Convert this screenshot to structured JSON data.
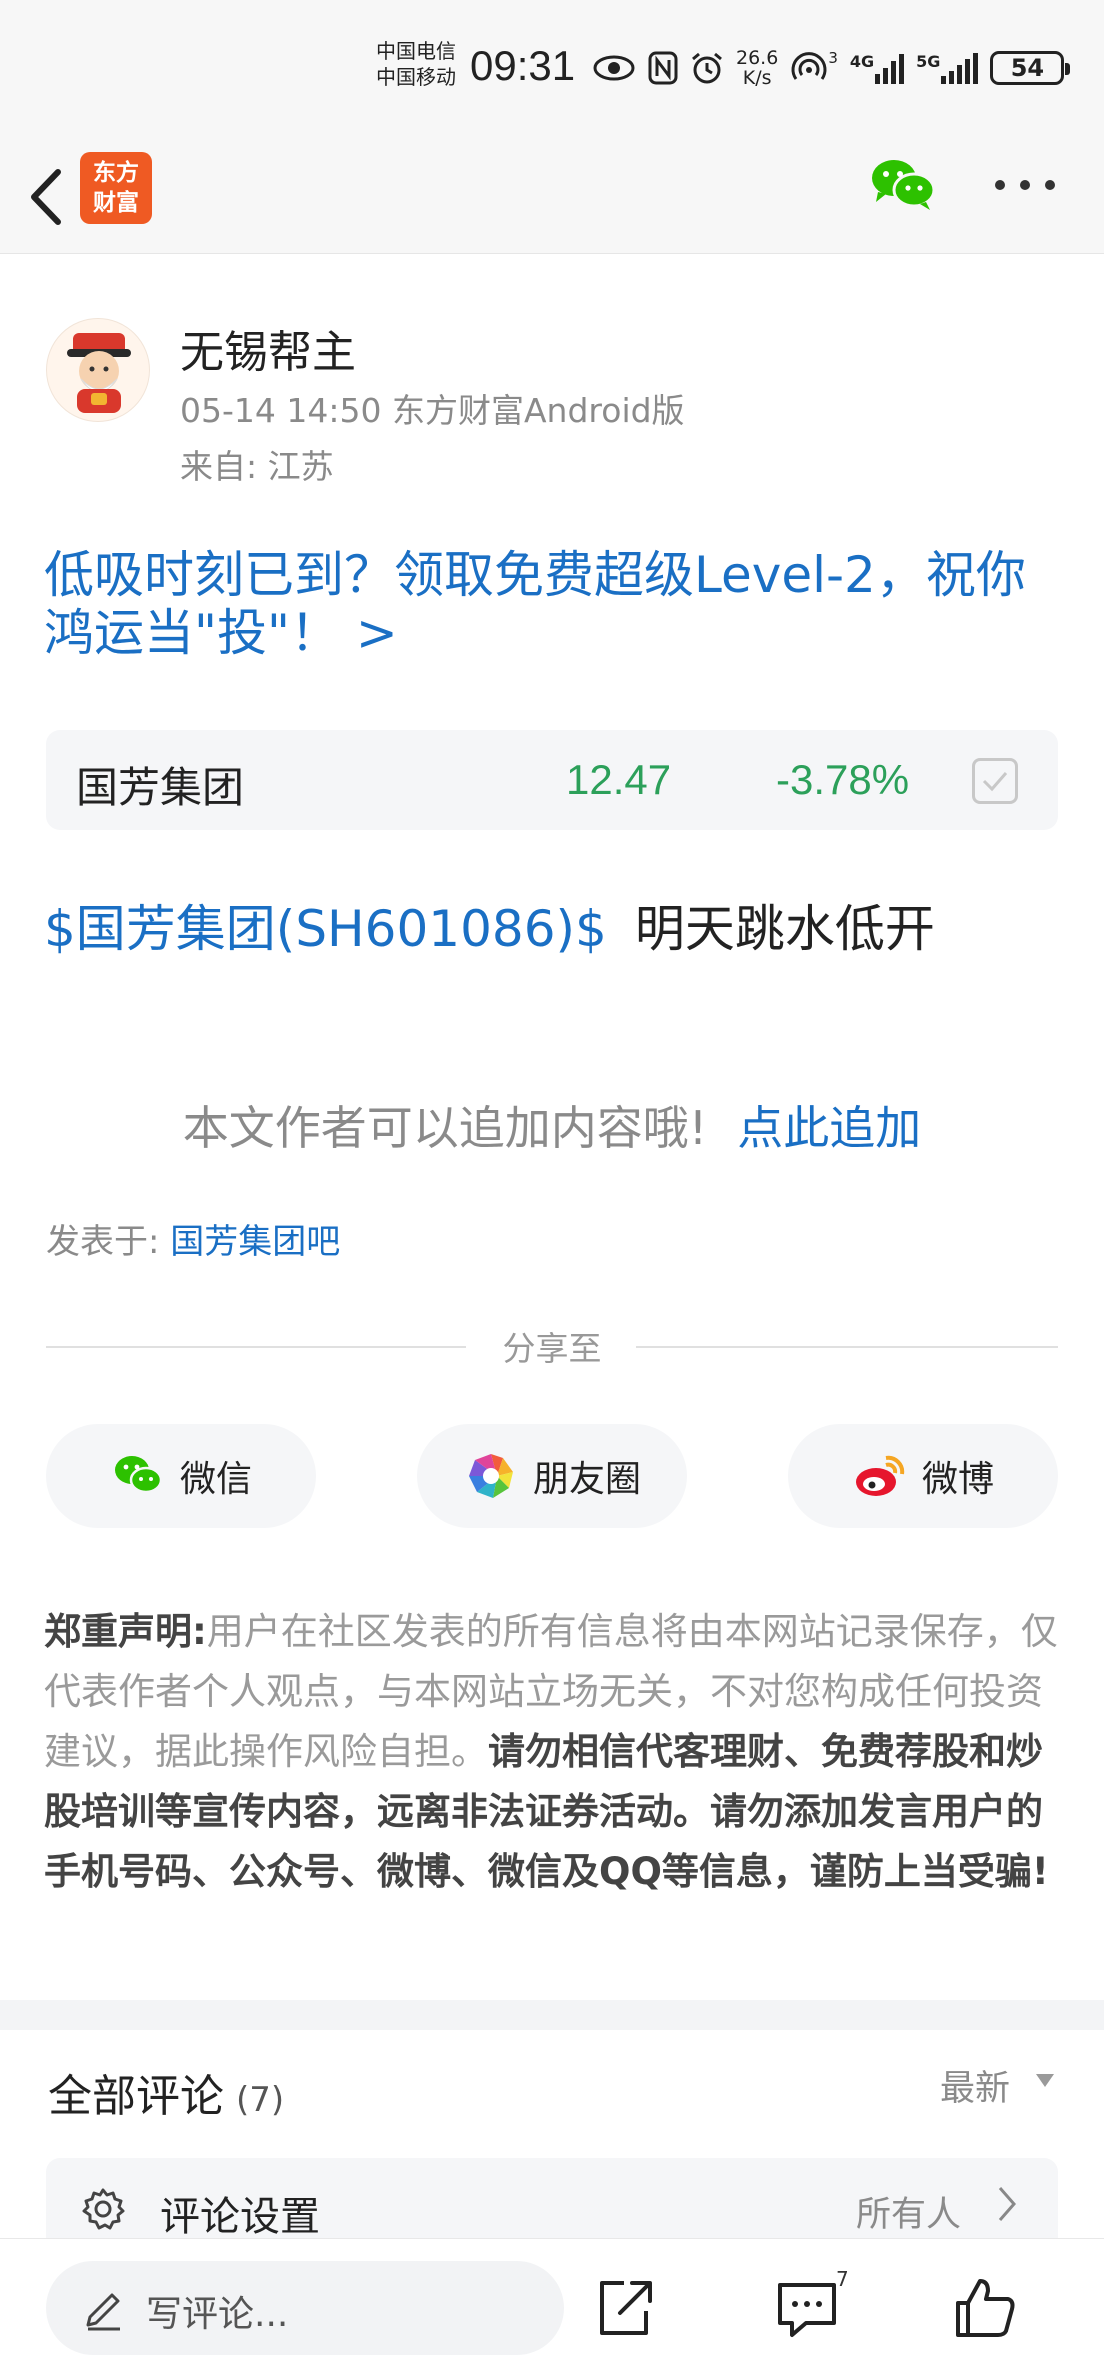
{
  "status_bar": {
    "carrier_1": "中国电信",
    "carrier_2": "中国移动",
    "time": "09:31",
    "net_speed_value": "26.6",
    "net_speed_unit": "K/s",
    "hotspot_sub": "3",
    "signal_1_label": "4G",
    "signal_2_label": "5G",
    "battery": "54"
  },
  "nav": {
    "logo_line_1": "东方",
    "logo_line_2": "财富",
    "icons": [
      "back-arrow-icon",
      "wechat-icon",
      "more-icon"
    ]
  },
  "post": {
    "author": "无锡帮主",
    "meta": "05-14 14:50 东方财富Android版",
    "from": "来自: 江苏",
    "promo": "低吸时刻已到？领取免费超级Level-2，祝你鸿运当\"投\"！ >",
    "stock": {
      "name": "国芳集团",
      "price": "12.47",
      "change": "-3.78%",
      "color": "#2ca05a"
    },
    "stock_tag": "$国芳集团(SH601086)$",
    "text": "明天跳水低开",
    "append_note": "本文作者可以追加内容哦!",
    "append_link": "点此追加",
    "posted_in_label": "发表于:",
    "posted_in_bar": "国芳集团吧"
  },
  "share": {
    "label": "分享至",
    "wechat": "微信",
    "moments": "朋友圈",
    "weibo": "微博"
  },
  "disclaimer": {
    "title": "郑重声明",
    "colon": ":",
    "normal": "用户在社区发表的所有信息将由本网站记录保存，仅代表作者个人观点，与本网站立场无关，不对您构成任何投资建议，据此操作风险自担。",
    "bold": "请勿相信代客理财、免费荐股和炒股培训等宣传内容，远离非法证券活动。请勿添加发言用户的手机号码、公众号、微博、微信及QQ等信息，谨防上当受骗!"
  },
  "comments": {
    "title": "全部评论",
    "count": "(7)",
    "sort": "最新",
    "settings_label": "评论设置",
    "settings_value": "所有人"
  },
  "bottom_bar": {
    "placeholder": "写评论...",
    "comment_badge": "7"
  },
  "colors": {
    "link_blue": "#1a6fc4",
    "stock_green": "#2ca05a",
    "brand_orange": "#ef5a23"
  }
}
